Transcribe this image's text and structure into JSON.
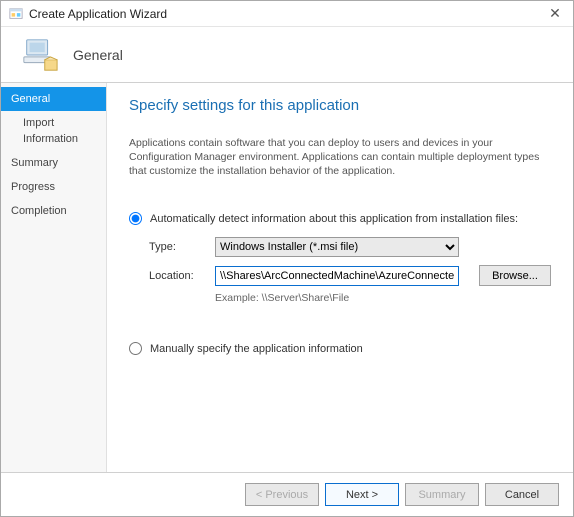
{
  "window": {
    "title": "Create Application Wizard",
    "close_glyph": "✕"
  },
  "header": {
    "title": "General"
  },
  "sidebar": {
    "items": [
      {
        "label": "General",
        "selected": true,
        "sub": false
      },
      {
        "label": "Import Information",
        "selected": false,
        "sub": true
      },
      {
        "label": "Summary",
        "selected": false,
        "sub": false
      },
      {
        "label": "Progress",
        "selected": false,
        "sub": false
      },
      {
        "label": "Completion",
        "selected": false,
        "sub": false
      }
    ]
  },
  "content": {
    "page_title": "Specify settings for this application",
    "description": "Applications contain software that you can deploy to users and devices in your Configuration Manager environment. Applications can contain multiple deployment types that customize the installation behavior of the application.",
    "option_auto_label": "Automatically detect information about this application from installation files:",
    "option_manual_label": "Manually specify the application information",
    "type_label": "Type:",
    "type_value": "Windows Installer (*.msi file)",
    "location_label": "Location:",
    "location_value": "\\\\Shares\\ArcConnectedMachine\\AzureConnectedMachineAgent.msi",
    "example_text": "Example: \\\\Server\\Share\\File",
    "browse_label": "Browse..."
  },
  "footer": {
    "previous": "< Previous",
    "next": "Next >",
    "summary": "Summary",
    "cancel": "Cancel"
  }
}
